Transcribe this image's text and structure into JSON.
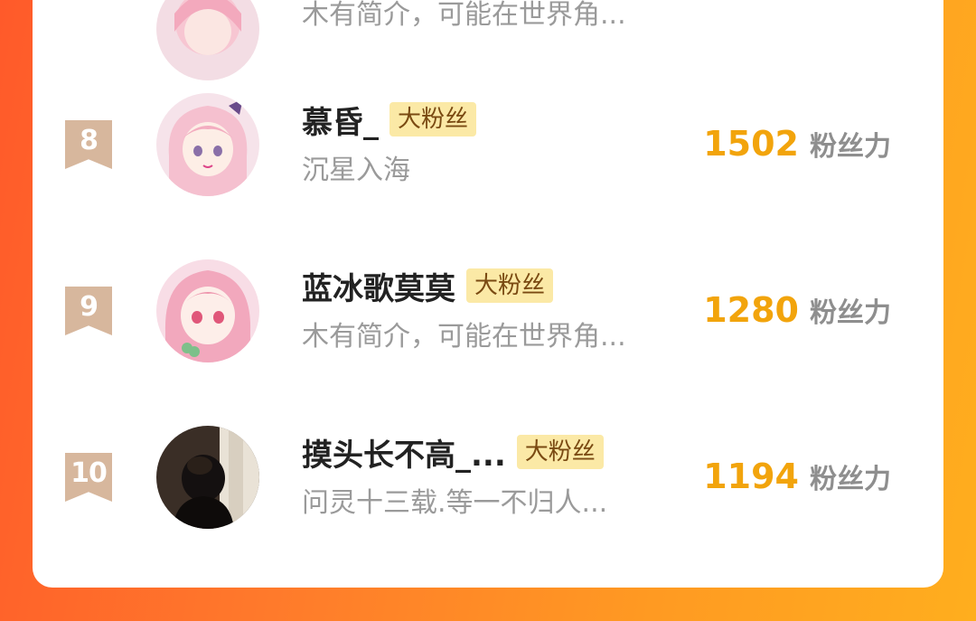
{
  "fan_tag_label": "大粉丝",
  "score_unit": "粉丝力",
  "top_partial": {
    "bio": "木有简介，可能在世界角..."
  },
  "rows": [
    {
      "rank": "8",
      "name": "慕昏_",
      "bio": "沉星入海",
      "score": "1502",
      "avatar": "anime-girl-pink-hair-avatar"
    },
    {
      "rank": "9",
      "name": "蓝冰歌莫莫",
      "bio": "木有简介，可能在世界角...",
      "score": "1280",
      "avatar": "anime-girl-pink-hair-avatar"
    },
    {
      "rank": "10",
      "name": "摸头长不高_...",
      "bio": "问灵十三载.等一不归人...",
      "score": "1194",
      "avatar": "person-photo-avatar"
    }
  ],
  "colors": {
    "background_start": "#ff5a2a",
    "background_end": "#ffae1e",
    "score": "#f2a40c",
    "rank_badge": "#d7b79d",
    "fan_tag_bg": "#fbe9a6"
  }
}
